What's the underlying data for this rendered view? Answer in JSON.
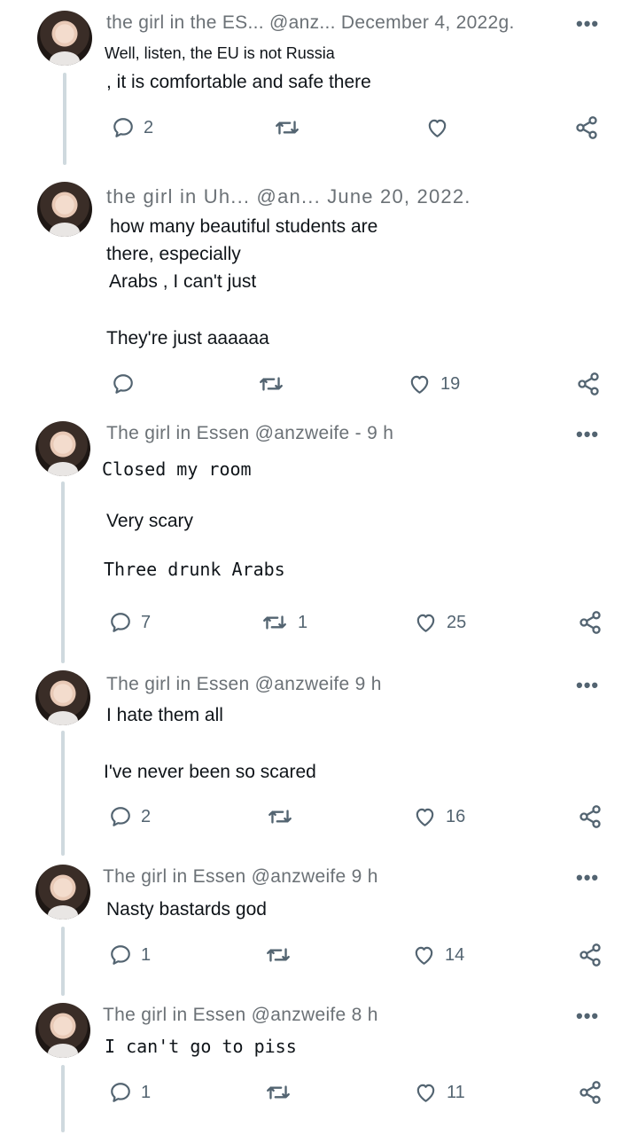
{
  "more_label": "•••",
  "tweets": [
    {
      "header": "the girl in the ES... @anz... December 4, 2022g.",
      "lines": [
        "Well, listen, the EU is not Russia",
        ", it is comfortable and safe there"
      ],
      "replies": "2",
      "retweets": "",
      "likes": ""
    },
    {
      "header": "the girl in Uh... @an... June 20, 2022.",
      "lines": [
        "how many beautiful students are",
        "there, especially",
        "Arabs , I can't just",
        "They're just aaaaaa"
      ],
      "replies": "",
      "retweets": "",
      "likes": "19"
    },
    {
      "header": "The girl in Essen @anzweife - 9 h",
      "lines": [
        "Closed my room",
        "Very scary",
        "Three drunk Arabs"
      ],
      "replies": "7",
      "retweets": "1",
      "likes": "25"
    },
    {
      "header": "The girl in Essen @anzweife 9 h",
      "lines": [
        "I hate them all",
        "I've never been so scared"
      ],
      "replies": "2",
      "retweets": "",
      "likes": "16"
    },
    {
      "header": "The girl in Essen @anzweife 9 h",
      "lines": [
        "Nasty bastards god"
      ],
      "replies": "1",
      "retweets": "",
      "likes": "14"
    },
    {
      "header": "The girl in Essen @anzweife 8 h",
      "lines": [
        "I can't go to piss"
      ],
      "replies": "1",
      "retweets": "",
      "likes": "11"
    }
  ]
}
